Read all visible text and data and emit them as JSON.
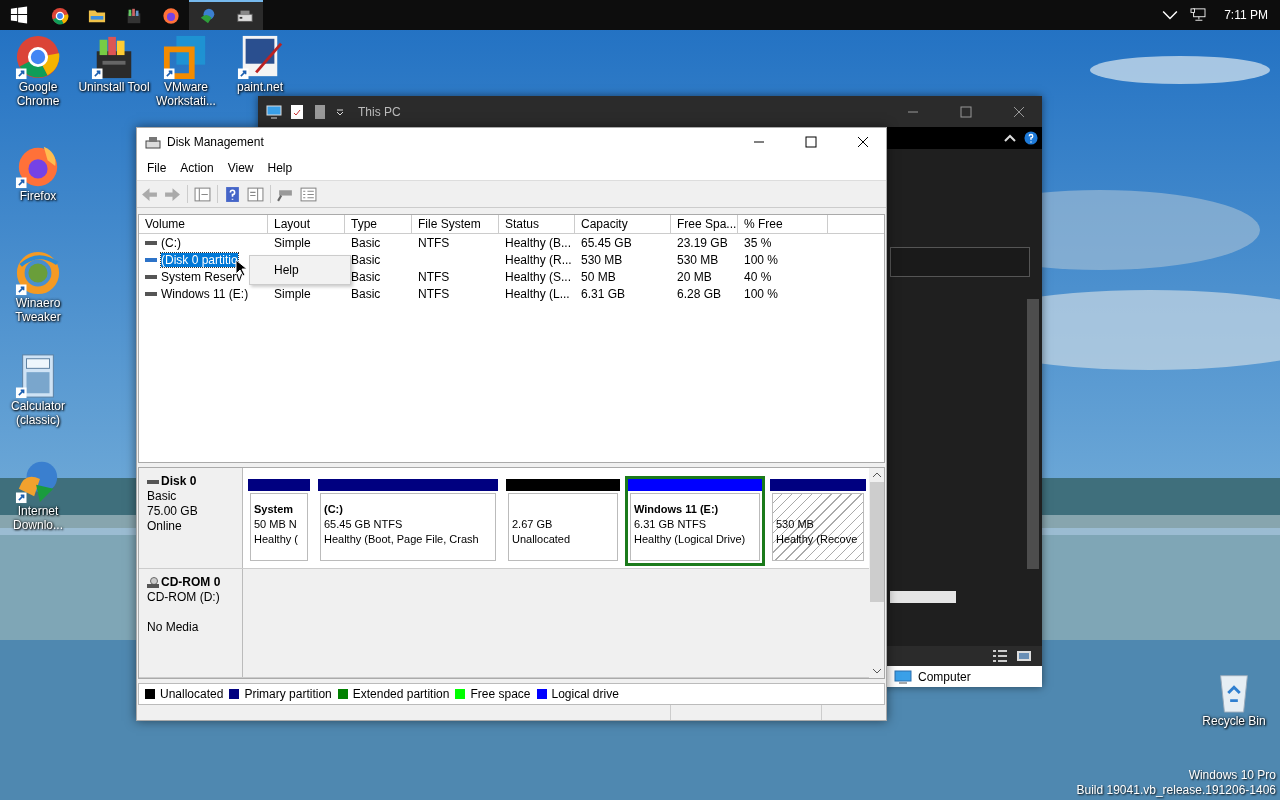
{
  "taskbar": {
    "apps": [
      {
        "kind": "chrome",
        "selected": false
      },
      {
        "kind": "folder",
        "selected": false
      },
      {
        "kind": "cabinet",
        "selected": false
      },
      {
        "kind": "firefox",
        "selected": false
      },
      {
        "kind": "globe",
        "selected": true
      },
      {
        "kind": "drive",
        "selected": true
      }
    ],
    "time": "7:11 PM"
  },
  "desktop_icons": [
    {
      "kind": "chrome",
      "label": "Google Chrome"
    },
    {
      "kind": "cabinet",
      "label": "Uninstall Tool"
    },
    {
      "kind": "vmware",
      "label": "VMware Workstati..."
    },
    {
      "kind": "paint",
      "label": "paint.net"
    },
    {
      "kind": "firefox",
      "label": "Firefox"
    },
    {
      "kind": "winaero",
      "label": "Winaero Tweaker"
    },
    {
      "kind": "calculator",
      "label": "Calculator (classic)"
    },
    {
      "kind": "idm",
      "label": "Internet Downlo..."
    },
    {
      "kind": "recycle",
      "label": "Recycle Bin"
    }
  ],
  "os_info": [
    "Windows 10 Pro",
    "Build 19041.vb_release.191206-1406"
  ],
  "explorer": {
    "title": "This PC",
    "status_item": "Computer"
  },
  "disk_management": {
    "title": "Disk Management",
    "menu": [
      "File",
      "Action",
      "View",
      "Help"
    ],
    "columns": [
      "Volume",
      "Layout",
      "Type",
      "File System",
      "Status",
      "Capacity",
      "Free Spa...",
      "% Free"
    ],
    "rows": [
      {
        "selected": false,
        "cells": [
          "(C:)",
          "Simple",
          "Basic",
          "NTFS",
          "Healthy (B...",
          "65.45 GB",
          "23.19 GB",
          "35 %"
        ]
      },
      {
        "selected": true,
        "cells": [
          "(Disk 0 partitio",
          "",
          "Basic",
          "",
          "Healthy (R...",
          "530 MB",
          "530 MB",
          "100 %"
        ]
      },
      {
        "selected": false,
        "cells": [
          "System Reserv",
          "",
          "Basic",
          "NTFS",
          "Healthy (S...",
          "50 MB",
          "20 MB",
          "40 %"
        ]
      },
      {
        "selected": false,
        "cells": [
          "Windows 11 (E:)",
          "Simple",
          "Basic",
          "NTFS",
          "Healthy (L...",
          "6.31 GB",
          "6.28 GB",
          "100 %"
        ]
      }
    ],
    "context_menu": [
      "Help"
    ],
    "disks": [
      {
        "kind": "disk",
        "name": "Disk 0",
        "lines": [
          "Basic",
          "75.00 GB",
          "Online"
        ],
        "partitions": [
          {
            "title": "System",
            "size": "50 MB N",
            "status": "Healthy (",
            "color": "#000080",
            "selected": false,
            "hatched": false
          },
          {
            "title": "(C:)",
            "size": "65.45 GB NTFS",
            "status": "Healthy (Boot, Page File, Crash",
            "color": "#000080",
            "selected": false,
            "hatched": false
          },
          {
            "size": "2.67 GB",
            "status": "Unallocated",
            "color": "#000000",
            "selected": false,
            "hatched": false
          },
          {
            "title": "Windows 11  (E:)",
            "size": "6.31 GB NTFS",
            "status": "Healthy (Logical Drive)",
            "color": "#0000ff",
            "selected": true,
            "hatched": false
          },
          {
            "size": "530 MB",
            "status": "Healthy (Recove",
            "color": "#000080",
            "selected": false,
            "hatched": true
          }
        ]
      },
      {
        "kind": "cdrom",
        "name": "CD-ROM 0",
        "drive": "CD-ROM (D:)",
        "media": "No Media"
      }
    ],
    "legend": [
      {
        "label": "Unallocated",
        "color": "#000000"
      },
      {
        "label": "Primary partition",
        "color": "#000080"
      },
      {
        "label": "Extended partition",
        "color": "#008000"
      },
      {
        "label": "Free space",
        "color": "#00ff00"
      },
      {
        "label": "Logical drive",
        "color": "#0000ff"
      }
    ]
  }
}
